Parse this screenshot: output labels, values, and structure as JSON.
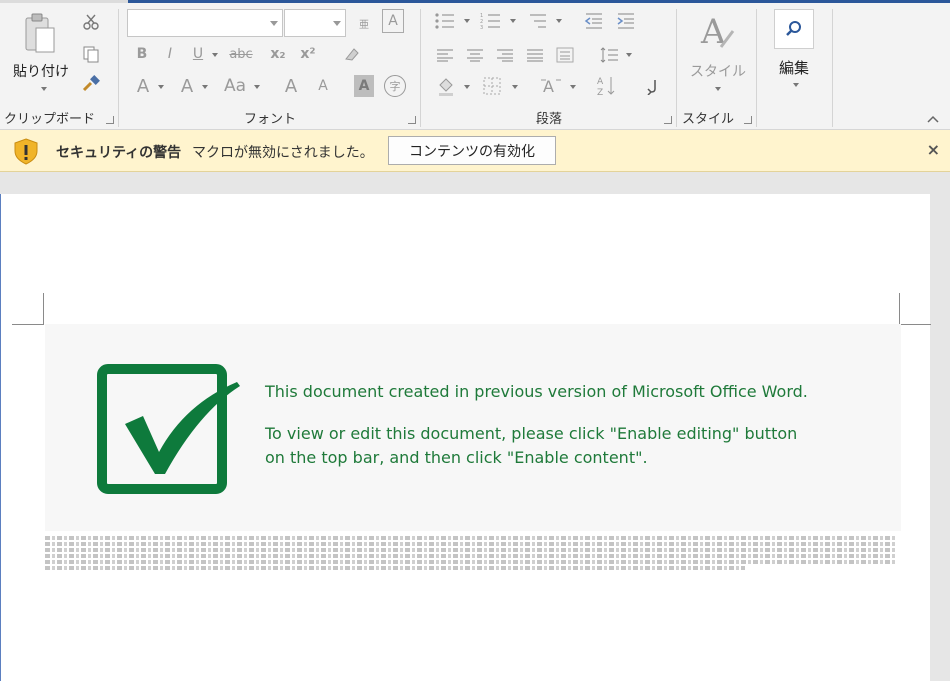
{
  "ribbon": {
    "clipboard": {
      "paste_label": "貼り付け",
      "group_label": "クリップボード"
    },
    "font": {
      "group_label": "フォント",
      "font_name": "",
      "font_size": "",
      "buttons": [
        "B",
        "I",
        "U",
        "abc",
        "x₂",
        "x²",
        "A",
        "A",
        "Aa",
        "A",
        "A",
        "A",
        "字"
      ]
    },
    "paragraph": {
      "group_label": "段落"
    },
    "styles": {
      "style_label": "スタイル",
      "group_label": "スタイル"
    },
    "editing": {
      "label": "編集"
    }
  },
  "security_bar": {
    "title": "セキュリティの警告",
    "message": "マクロが無効にされました。",
    "button_label": "コンテンツの有効化",
    "close_glyph": "×"
  },
  "document": {
    "line1": "This document created in previous version of Microsoft Office Word.",
    "line2": "To view or edit this document, please click \"Enable editing\" button",
    "line3": "on the top bar, and then click \"Enable content\"."
  },
  "colors": {
    "accent": "#2b579a",
    "security_bar_bg": "#fff4ce",
    "banner_green": "#1f7a3a",
    "checkbox_green": "#0e7a3c"
  },
  "icons": {
    "shield": "warning-shield-icon",
    "check": "checkmark-box-icon",
    "search": "search-icon"
  }
}
